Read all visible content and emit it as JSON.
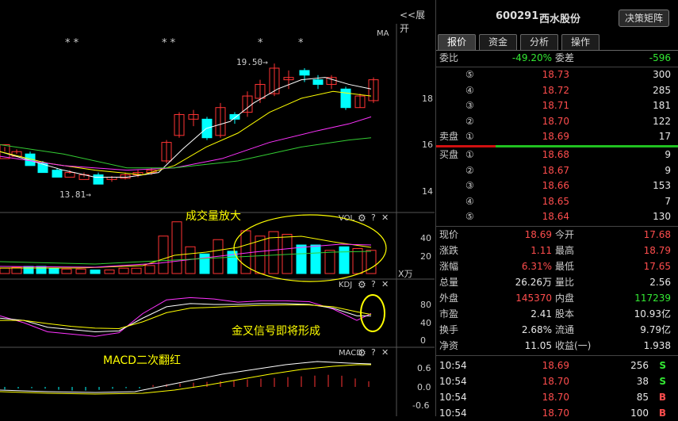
{
  "chart_panel": {
    "expand_label": "<<展开",
    "ma_label": "MA",
    "vol_label": "VOL",
    "kdj_label": "KDJ",
    "macd_label": "MACD",
    "price_axis": [
      "18",
      "16",
      "14"
    ],
    "vol_axis": [
      "40",
      "20"
    ],
    "vol_unit": "X万",
    "kdj_axis": [
      "80",
      "40",
      "0"
    ],
    "macd_axis": [
      "0.6",
      "0.0",
      "-0.6"
    ],
    "high_marker": "19.50",
    "low_marker": "13.81",
    "star_marks": [
      "* *",
      "* *",
      "*",
      "*"
    ],
    "annotation_volume": "成交量放大",
    "annotation_golden_cross": "金叉信号即将形成",
    "annotation_macd": "MACD二次翻红",
    "icon_gear": "gear-icon",
    "icon_help": "?",
    "icon_close": "✕",
    "colors": {
      "up": "#ff3333",
      "down": "#00ffff",
      "annotation": "#ffff00",
      "ma_white": "#ffffff",
      "ma_yellow": "#ffff00",
      "ma_magenta": "#ff33ff",
      "ma_green": "#33cc33"
    }
  },
  "quote_panel": {
    "stock_code": "600291",
    "stock_name": "西水股份",
    "decision_button": "决策矩阵",
    "tabs": [
      "报价",
      "资金",
      "分析",
      "操作"
    ],
    "weibi_label": "委比",
    "weibi_value": "-49.20%",
    "weicha_label": "委差",
    "weicha_value": "-596",
    "sell_label": "卖盘",
    "buy_label": "买盘",
    "sell_orders": [
      {
        "level": "⑤",
        "price": "18.73",
        "volume": "300"
      },
      {
        "level": "④",
        "price": "18.72",
        "volume": "285"
      },
      {
        "level": "③",
        "price": "18.71",
        "volume": "181"
      },
      {
        "level": "②",
        "price": "18.70",
        "volume": "122"
      },
      {
        "level": "①",
        "price": "18.69",
        "volume": "17"
      }
    ],
    "buy_orders": [
      {
        "level": "①",
        "price": "18.68",
        "volume": "9"
      },
      {
        "level": "②",
        "price": "18.67",
        "volume": "9"
      },
      {
        "level": "③",
        "price": "18.66",
        "volume": "153"
      },
      {
        "level": "④",
        "price": "18.65",
        "volume": "7"
      },
      {
        "level": "⑤",
        "price": "18.64",
        "volume": "130"
      }
    ],
    "stats": [
      {
        "l1": "现价",
        "v1": "18.69",
        "c1": "red",
        "l2": "今开",
        "v2": "17.68",
        "c2": "red"
      },
      {
        "l1": "涨跌",
        "v1": "1.11",
        "c1": "red",
        "l2": "最高",
        "v2": "18.79",
        "c2": "red"
      },
      {
        "l1": "涨幅",
        "v1": "6.31%",
        "c1": "red",
        "l2": "最低",
        "v2": "17.65",
        "c2": "red"
      },
      {
        "l1": "总量",
        "v1": "26.26万",
        "c1": "white",
        "l2": "量比",
        "v2": "2.56",
        "c2": "white"
      },
      {
        "l1": "外盘",
        "v1": "145370",
        "c1": "red",
        "l2": "内盘",
        "v2": "117239",
        "c2": "green"
      },
      {
        "l1": "市盈",
        "v1": "2.41",
        "c1": "white",
        "l2": "股本",
        "v2": "10.93亿",
        "c2": "white"
      },
      {
        "l1": "换手",
        "v1": "2.68%",
        "c1": "white",
        "l2": "流通",
        "v2": "9.79亿",
        "c2": "white"
      },
      {
        "l1": "净资",
        "v1": "11.05",
        "c1": "white",
        "l2": "收益(一)",
        "v2": "1.938",
        "c2": "white"
      }
    ],
    "trades": [
      {
        "time": "10:54",
        "price": "18.69",
        "volume": "256",
        "side": "S"
      },
      {
        "time": "10:54",
        "price": "18.70",
        "volume": "38",
        "side": "S"
      },
      {
        "time": "10:54",
        "price": "18.70",
        "volume": "85",
        "side": "B"
      },
      {
        "time": "10:54",
        "price": "18.70",
        "volume": "100",
        "side": "B"
      }
    ]
  }
}
